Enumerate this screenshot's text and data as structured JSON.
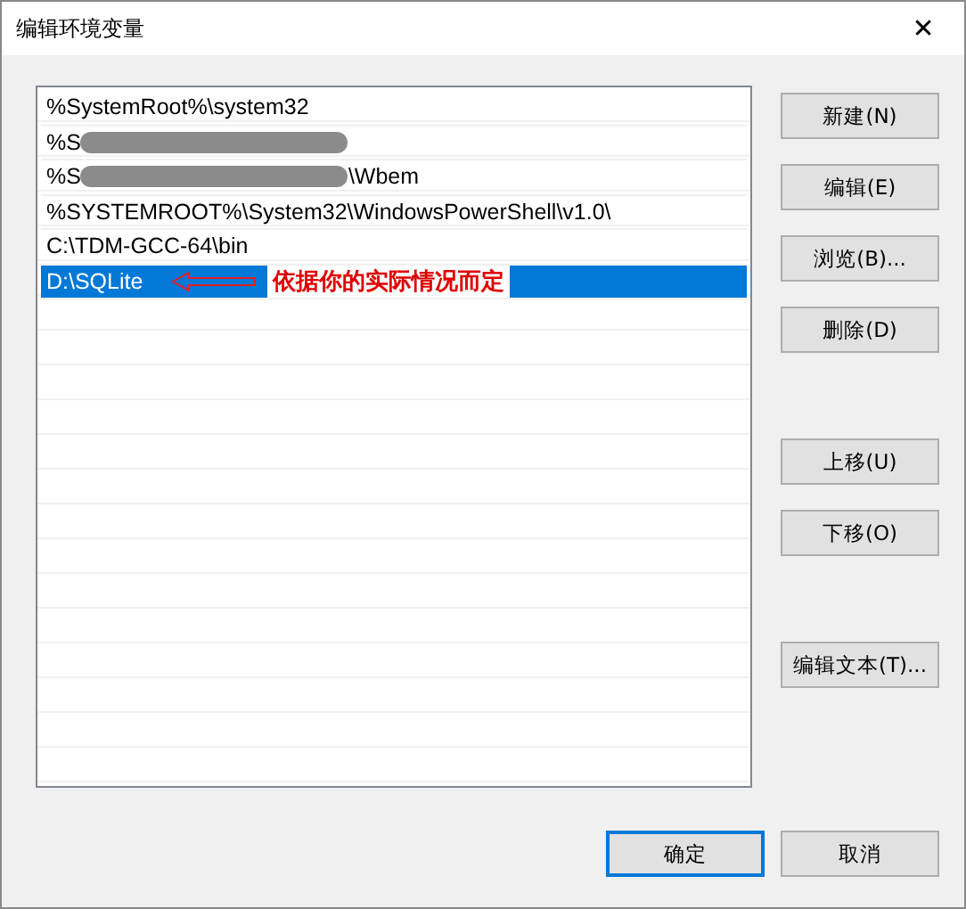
{
  "window": {
    "title": "编辑环境变量",
    "close": "✕"
  },
  "entries": [
    {
      "prefix": "%SystemRoot%\\system32",
      "redacted": false,
      "selected": false
    },
    {
      "prefix": "%S",
      "redacted": true,
      "selected": false
    },
    {
      "prefix": "%S",
      "redacted": true,
      "suffix": "\\Wbem",
      "selected": false
    },
    {
      "prefix": "%SYSTEMROOT%\\System32\\WindowsPowerShell\\v1.0\\",
      "redacted": false,
      "selected": false
    },
    {
      "prefix": "C:\\TDM-GCC-64\\bin",
      "redacted": false,
      "selected": false
    },
    {
      "prefix": "D:\\SQLite",
      "redacted": false,
      "selected": true,
      "note": "依据你的实际情况而定"
    }
  ],
  "side_button_groups": [
    [
      "新建(N)",
      "编辑(E)",
      "浏览(B)...",
      "删除(D)"
    ],
    [
      "上移(U)",
      "下移(O)"
    ],
    [
      "编辑文本(T)..."
    ]
  ],
  "footer_buttons": [
    {
      "label": "确定",
      "default": true
    },
    {
      "label": "取消",
      "default": false
    }
  ]
}
